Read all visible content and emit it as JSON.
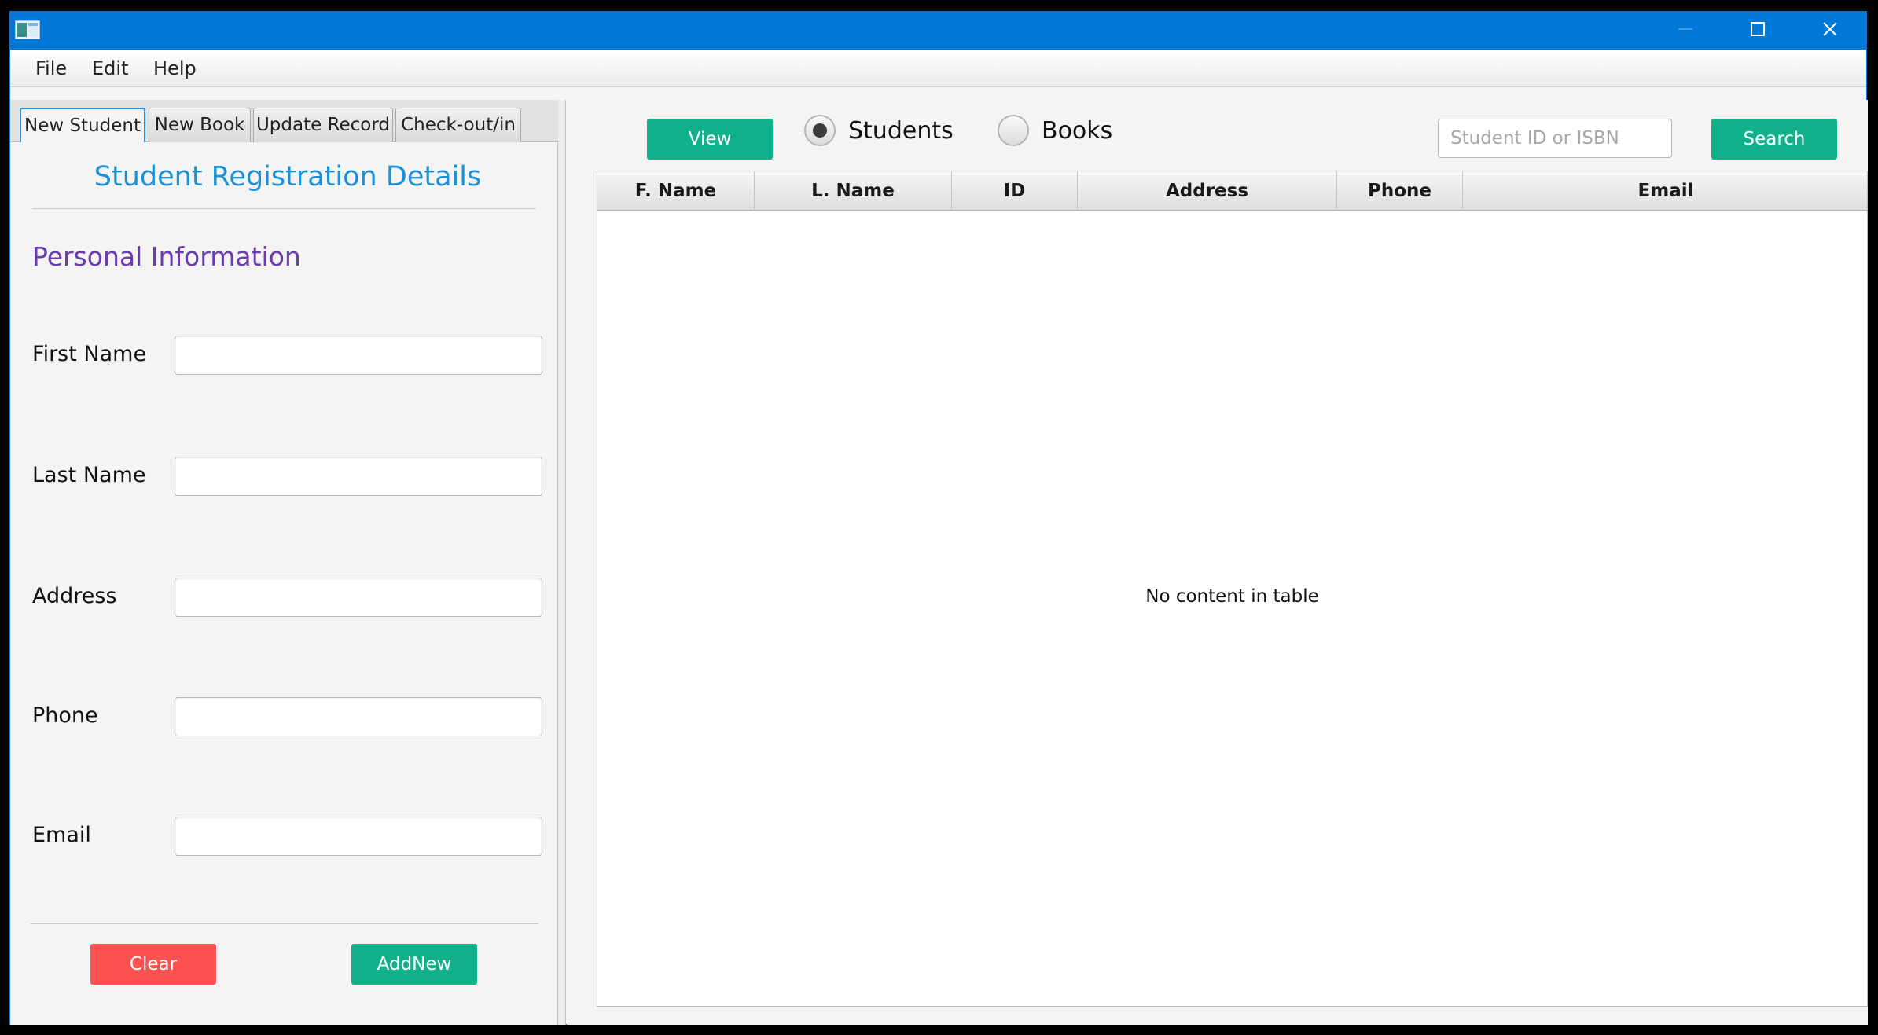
{
  "menu": {
    "file": "File",
    "edit": "Edit",
    "help": "Help"
  },
  "tabs": [
    {
      "label": "New Student"
    },
    {
      "label": "New Book"
    },
    {
      "label": "Update Record"
    },
    {
      "label": "Check-out/in"
    }
  ],
  "form": {
    "title": "Student Registration Details",
    "section_title": "Personal Information",
    "fields": [
      {
        "label": "First Name",
        "value": ""
      },
      {
        "label": "Last Name",
        "value": ""
      },
      {
        "label": "Address",
        "value": ""
      },
      {
        "label": "Phone",
        "value": ""
      },
      {
        "label": "Email",
        "value": ""
      }
    ],
    "clear_label": "Clear",
    "add_label": "AddNew"
  },
  "toolbar": {
    "view_label": "View",
    "radio_students": "Students",
    "radio_books": "Books",
    "selected": "Students",
    "search_placeholder": "Student ID or ISBN",
    "search_value": "",
    "search_label": "Search"
  },
  "table": {
    "columns": [
      "F. Name",
      "L. Name",
      "ID",
      "Address",
      "Phone",
      "Email"
    ],
    "rows": [],
    "empty_message": "No content in table"
  },
  "colors": {
    "titlebar": "#0078d7",
    "accent_green": "#10b08a",
    "accent_red": "#fb5150",
    "title_blue": "#1d91d6",
    "section_purple": "#6a3cb0"
  },
  "icons": {
    "app": "window-app-icon",
    "minimize": "minimize-icon",
    "maximize": "maximize-icon",
    "close": "close-icon"
  }
}
